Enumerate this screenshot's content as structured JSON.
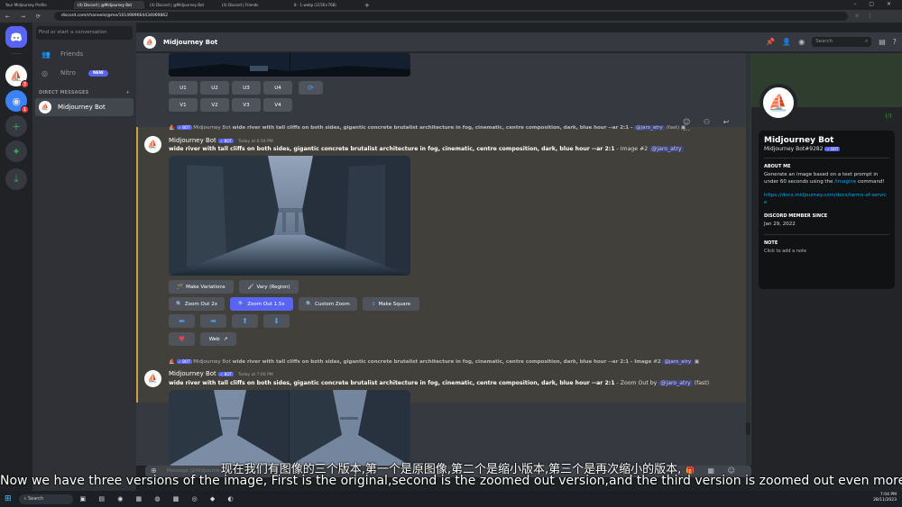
{
  "browser": {
    "tabs": [
      "Your Midjourney Profile",
      "(4) Discord | @Midjourney Bot",
      "(4) Discord | @Midjourney Bot",
      "(4) Discord | Friends",
      "8 - 1.webp (1156×768)"
    ],
    "url": "discord.com/channels/@me/1014989664434069862"
  },
  "dm": {
    "search_placeholder": "Find or start a conversation",
    "friends_label": "Friends",
    "nitro_label": "Nitro",
    "nitro_badge": "NEW",
    "direct_messages_header": "DIRECT MESSAGES",
    "active_dm": "Midjourney Bot"
  },
  "servers": {
    "badge_1": "3",
    "badge_2": "1"
  },
  "header": {
    "title": "Midjourney Bot",
    "search_placeholder": "Search"
  },
  "prev_message": {
    "upscale_buttons": [
      "U1",
      "U2",
      "U3",
      "U4"
    ],
    "variation_buttons": [
      "V1",
      "V2",
      "V3",
      "V4"
    ]
  },
  "message1": {
    "reply_bot_tag": "✓ BOT",
    "reply_author": "Midjourney Bot",
    "reply_text": "wide river with tall cliffs on both sides, gigantic concrete brutalist architecture in fog, cinematic, centre composition, dark, blue hour --ar 2:1 -",
    "reply_mention": "@jaro_atry",
    "reply_suffix": "(fast)",
    "author": "Midjourney Bot",
    "bot_tag": "✓ BOT",
    "timestamp": "Today at 6:59 PM",
    "prompt": "wide river with tall cliffs on both sides, gigantic concrete brutalist architecture in fog, cinematic, centre composition, dark, blue hour --ar 2:1",
    "prompt_suffix": "- Image #2",
    "mention": "@jaro_atry",
    "buttons": {
      "make_variations": "Make Variations",
      "vary_region": "Vary (Region)",
      "zoom_out_2x": "Zoom Out 2x",
      "zoom_out_15x": "Zoom Out 1.5x",
      "custom_zoom": "Custom Zoom",
      "make_square": "Make Square",
      "web": "Web"
    }
  },
  "message2": {
    "reply_bot_tag": "✓ BOT",
    "reply_author": "Midjourney Bot",
    "reply_text": "wide river with tall cliffs on both sides, gigantic concrete brutalist architecture in fog, cinematic, centre composition, dark, blue hour --ar 2:1 - Image #2",
    "reply_mention": "@jaro_atry",
    "author": "Midjourney Bot",
    "bot_tag": "✓ BOT",
    "timestamp": "Today at 7:00 PM",
    "prompt": "wide river with tall cliffs on both sides, gigantic concrete brutalist architecture in fog, cinematic, centre composition, dark, blue hour --ar 2:1",
    "prompt_suffix": "- Zoom Out by",
    "mention": "@jaro_atry",
    "prompt_end": "(fast)"
  },
  "composer": {
    "placeholder": "Message @Midjourney Bot"
  },
  "profile": {
    "name": "Midjourney Bot",
    "tag": "Midjourney Bot#9282",
    "bot_tag": "✓ BOT",
    "about_header": "ABOUT ME",
    "about_text": "Generate an image based on a text prompt in under 60 seconds using the",
    "about_command": "/imagine",
    "about_end": "command!",
    "link": "https://docs.midjourney.com/docs/terms-of-service",
    "member_since_header": "DISCORD MEMBER SINCE",
    "member_since": "Jan 29, 2022",
    "note_header": "NOTE",
    "note_placeholder": "Click to add a note"
  },
  "subtitles": {
    "zh": "现在我们有图像的三个版本,第一个是原图像,第二个是缩小版本,第三个是再次缩小的版本,",
    "en": "Now we have three versions of the image, First is the original,second is the zoomed out version,and the third version is zoomed out even more,"
  },
  "taskbar": {
    "search_label": "Search",
    "time": "7:04 PM",
    "date": "28/11/2023"
  },
  "colors": {
    "blurple": "#5865f2",
    "highlight_bar": "#c9a240",
    "heart": "#ed4245"
  }
}
